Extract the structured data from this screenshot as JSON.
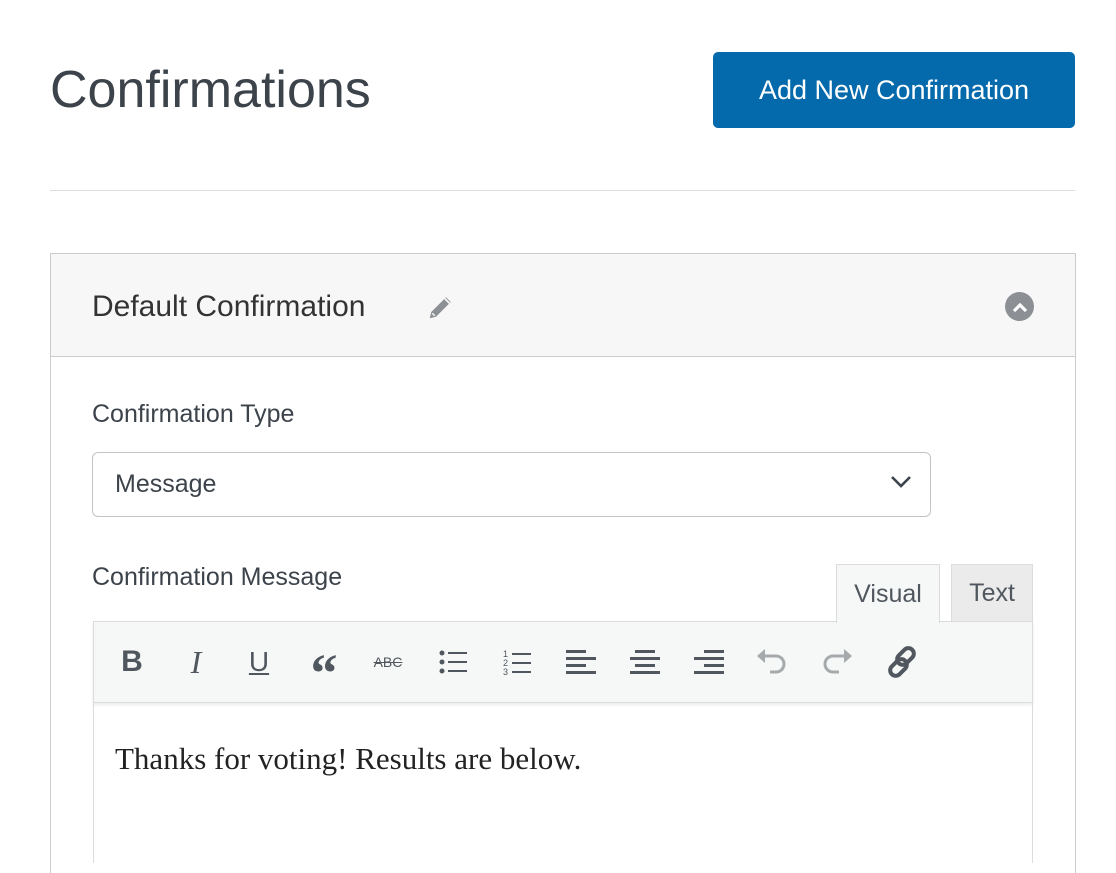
{
  "page": {
    "title": "Confirmations",
    "add_button": "Add New Confirmation"
  },
  "panel": {
    "title": "Default Confirmation",
    "type_label": "Confirmation Type",
    "type_value": "Message",
    "message_label": "Confirmation Message",
    "tabs": [
      {
        "label": "Visual",
        "active": true
      },
      {
        "label": "Text",
        "active": false
      }
    ],
    "toolbar": [
      "bold",
      "italic",
      "underline",
      "blockquote",
      "strikethrough",
      "bulleted-list",
      "numbered-list",
      "align-left",
      "align-center",
      "align-right",
      "undo",
      "redo",
      "link"
    ],
    "content": "Thanks for voting! Results are below."
  },
  "colors": {
    "accent": "#056aab"
  }
}
